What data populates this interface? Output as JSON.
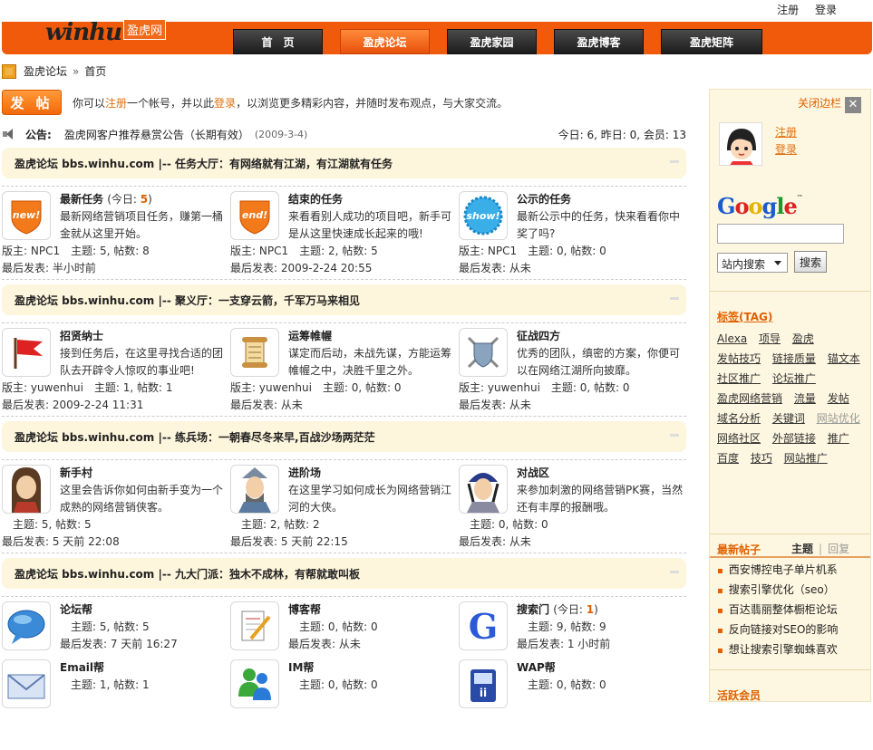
{
  "header": {
    "logo_text": "winhu",
    "logo_cn": "盈虎网",
    "register": "注册",
    "login": "登录",
    "nav": [
      "首　页",
      "盈虎论坛",
      "盈虎家园",
      "盈虎博客",
      "盈虎矩阵"
    ],
    "active_index": 1,
    "accent": "#f05a0a"
  },
  "breadcrumb": {
    "home": "盈虎论坛",
    "sep": "»",
    "current": "首页"
  },
  "post_row": {
    "button": "发 帖",
    "prefix": "你可以",
    "register": "注册",
    "mid": "一个帐号，并以此",
    "login": "登录",
    "suffix": "，以浏览更多精彩内容，并随时发布观点，与大家交流。"
  },
  "notice": {
    "label": "公告:",
    "text": "盈虎网客户推荐悬赏公告（长期有效）",
    "date": "(2009-3-4)",
    "stats": "今日: 6, 昨日: 0, 会员: 13"
  },
  "sections": [
    {
      "title": "盈虎论坛 bbs.winhu.com |-- 任务大厅：有网络就有江湖，有江湖就有任务",
      "forums": [
        {
          "icon": "new-badge-icon",
          "title": "最新任务",
          "today_label": "(今日: ",
          "today": "5",
          "today_end": ")",
          "desc": "最新网络营销项目任务，赚第一桶金就从这里开始。",
          "stat1": "版主: NPC1　主题: 5, 帖数: 8",
          "stat2": "最后发表: 半小时前"
        },
        {
          "icon": "end-badge-icon",
          "title": "结束的任务",
          "desc": "来看看别人成功的项目吧，新手可是从这里快速成长起来的哦!",
          "stat1": "版主: NPC1　主题: 2, 帖数: 5",
          "stat2": "最后发表: 2009-2-24 20:55"
        },
        {
          "icon": "show-badge-icon",
          "title": "公示的任务",
          "desc": "最新公示中的任务，快来看看你中奖了吗?",
          "stat1": "版主: NPC1　主题: 0, 帖数: 0",
          "stat2": "最后发表: 从未"
        }
      ]
    },
    {
      "title": "盈虎论坛 bbs.winhu.com |-- 聚义厅：一支穿云箭，千军万马来相见",
      "forums": [
        {
          "icon": "flag-icon",
          "title": "招贤纳士",
          "desc": "接到任务后，在这里寻找合适的团队去开辟令人惊叹的事业吧!",
          "stat1": "版主: yuwenhui　主题: 1, 帖数: 1",
          "stat2": "最后发表: 2009-2-24 11:31"
        },
        {
          "icon": "scroll-icon",
          "title": "运筹帷幄",
          "desc": "谋定而后动，未战先谋，方能运筹帷幄之中，决胜千里之外。",
          "stat1": "版主: yuwenhui　主题: 0, 帖数: 0",
          "stat2": "最后发表: 从未"
        },
        {
          "icon": "shield-swords-icon",
          "title": "征战四方",
          "desc": "优秀的团队，缜密的方案，你便可以在网络江湖所向披靡。",
          "stat1": "版主: yuwenhui　主题: 0, 帖数: 0",
          "stat2": "最后发表: 从未"
        }
      ]
    },
    {
      "title": "盈虎论坛 bbs.winhu.com |-- 练兵场：一朝春尽冬来早,百战沙场两茫茫",
      "forums": [
        {
          "icon": "warrior-icon",
          "title": "新手村",
          "desc": "这里会告诉你如何由新手变为一个成熟的网络营销侠客。",
          "stat1": "　主题: 5, 帖数: 5",
          "stat2": "最后发表: 5 天前 22:08"
        },
        {
          "icon": "general-icon",
          "title": "进阶场",
          "desc": "在这里学习如何成长为网络营销江河的大侠。",
          "stat1": "　主题: 2, 帖数: 2",
          "stat2": "最后发表: 5 天前 22:15"
        },
        {
          "icon": "knight-icon",
          "title": "对战区",
          "desc": "来参加刺激的网络营销PK赛，当然还有丰厚的报酬哦。",
          "stat1": "　主题: 0, 帖数: 0",
          "stat2": "最后发表: 从未"
        }
      ]
    },
    {
      "title": "盈虎论坛 bbs.winhu.com |-- 九大门派：独木不成林，有帮就敢叫板",
      "forums": [
        {
          "icon": "chat-bubble-icon",
          "title": "论坛帮",
          "stat1": "　主题: 5, 帖数: 5",
          "stat2": "最后发表: 7 天前 16:27"
        },
        {
          "icon": "notepad-icon",
          "title": "博客帮",
          "stat1": "　主题: 0, 帖数: 0",
          "stat2": "最后发表: 从未"
        },
        {
          "icon": "google-g-icon",
          "title": "搜索门",
          "today_label": "(今日: ",
          "today": "1",
          "today_end": ")",
          "stat1": "　主题: 9, 帖数: 9",
          "stat2": "最后发表: 1 小时前"
        },
        {
          "icon": "envelope-icon",
          "title": "Email帮",
          "stat1": "　主题: 1, 帖数: 1"
        },
        {
          "icon": "messenger-icon",
          "title": "IM帮",
          "stat1": "　主题: 0, 帖数: 0"
        },
        {
          "icon": "phone-icon",
          "title": "WAP帮",
          "stat1": "　主题: 0, 帖数: 0"
        }
      ]
    }
  ],
  "sidebar": {
    "close_label": "关闭边栏",
    "register": "注册",
    "login": "登录",
    "search_select": "站内搜索",
    "search_button": "搜索",
    "google_logo": "Google",
    "tag_title": "标签(TAG)",
    "tags": [
      "Alexa",
      "项导",
      "盈虎",
      "发帖技巧",
      "链接质量",
      "锚文本",
      "社区推广",
      "论坛推广",
      "盈虎网络营销",
      "流量",
      "发帖",
      "域名分析",
      "关键词",
      "网站优化",
      "网络社区",
      "外部链接",
      "推广",
      "百度",
      "技巧",
      "网站推广"
    ],
    "new_posts_title": "最新帖子",
    "tab_topics": "主题",
    "tab_replies": "回复",
    "new_posts": [
      "西安博控电子单片机系",
      "搜索引擎优化（seo）",
      "百达翡丽整体橱柜论坛",
      "反向链接对SEO的影响",
      "想让搜索引擎蜘蛛喜欢"
    ],
    "active_members": "活跃会员"
  }
}
